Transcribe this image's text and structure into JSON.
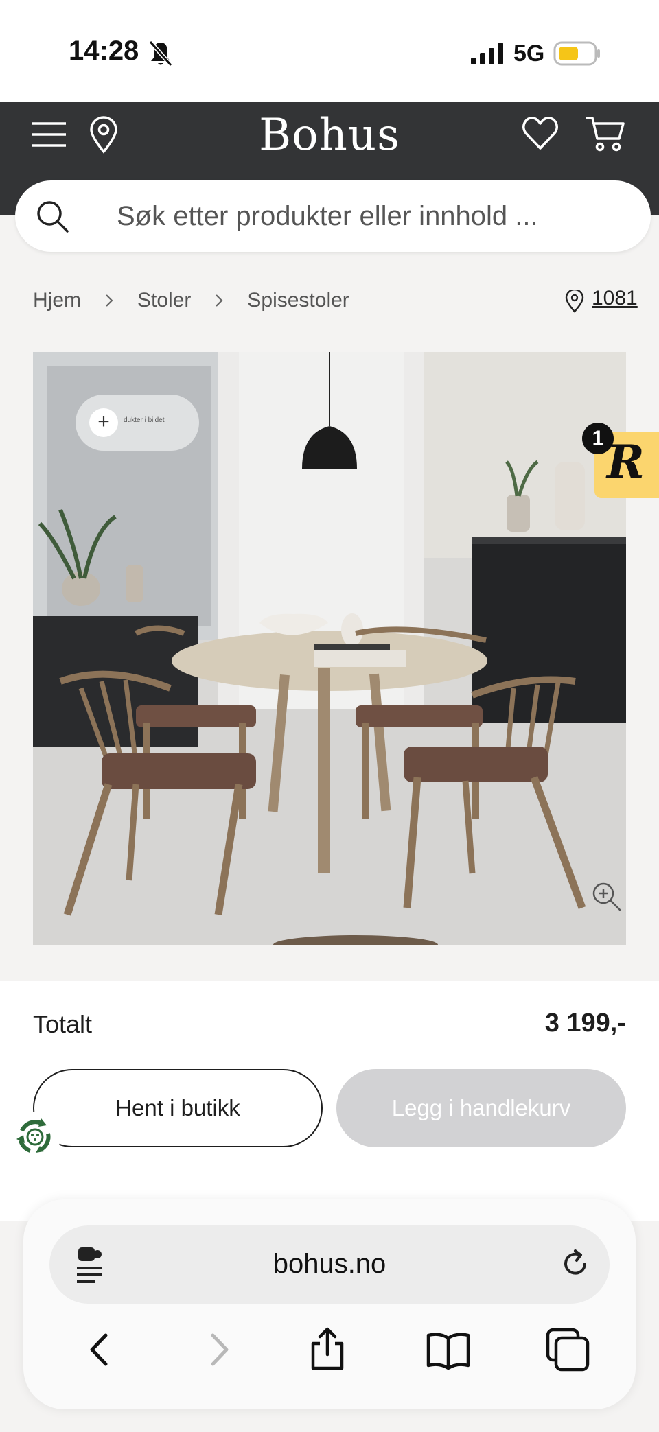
{
  "status_bar": {
    "time": "14:28",
    "network": "5G",
    "battery_color": "#f5c518"
  },
  "header": {
    "brand": "Bohus",
    "background": "#333436"
  },
  "search": {
    "placeholder": "Søk etter produkter eller innhold ..."
  },
  "breadcrumb": {
    "items": [
      "Hjem",
      "Stoler",
      "Spisestoler"
    ],
    "store": "1081"
  },
  "product_image": {
    "hotspot_label": "dukter i bildet",
    "hotspot_symbol": "+"
  },
  "review_badge": {
    "letter": "R",
    "count": "1",
    "color": "#fbd56e"
  },
  "buy_panel": {
    "total_label": "Totalt",
    "total_price": "3 199,-",
    "pickup_button": "Hent i butikk",
    "cart_button": "Legg i handlekurv"
  },
  "browser": {
    "url": "bohus.no"
  }
}
